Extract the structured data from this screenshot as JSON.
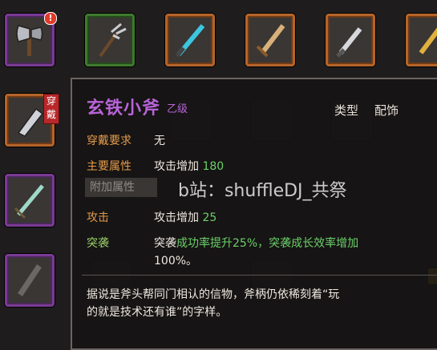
{
  "inventory": {
    "alert_badge": "!",
    "equipped_badge": "穿戴",
    "slots": [
      {
        "icon": "axe-icon",
        "rarity": "purple"
      },
      {
        "icon": "trident-icon",
        "rarity": "green"
      },
      {
        "icon": "cyan-sword-icon",
        "rarity": "orange"
      },
      {
        "icon": "bronze-sword-icon",
        "rarity": "orange"
      },
      {
        "icon": "silver-dagger-icon",
        "rarity": "orange"
      },
      {
        "icon": "gold-sword-icon",
        "rarity": "orange"
      },
      {
        "icon": "broad-blade-icon",
        "rarity": "orange"
      },
      {
        "icon": "jade-sword-icon",
        "rarity": "purple"
      },
      {
        "icon": "dark-blade-icon",
        "rarity": "purple"
      }
    ]
  },
  "tooltip": {
    "item_name": "玄铁小斧",
    "grade": "乙级",
    "type_label": "类型",
    "type_value": "配饰",
    "requirement_label": "穿戴要求",
    "requirement_value": "无",
    "main_attr_label": "主要属性",
    "main_attr_text": "攻击增加",
    "main_attr_value": "180",
    "extra_attr_label": "附加属性",
    "attack_label": "攻击",
    "attack_text": "攻击增加",
    "attack_value": "25",
    "breakthrough_label": "突袭",
    "breakthrough_prefix": "突袭",
    "breakthrough_line1": "成功率提升25%，突袭成长效率增加",
    "breakthrough_line2": "100%。",
    "description_line1": "据说是斧头帮同门相认的信物，斧柄仍依稀刻着“玩",
    "description_line2": "的就是技术还有谁”的字样。"
  },
  "watermark": "b站：shuffleDJ_共祭",
  "colors": {
    "purple_rarity": "#7a3a94",
    "orange_rarity": "#b5642a",
    "green_rarity": "#3f7a2e",
    "item_name": "#b864d8",
    "label_orange": "#e29a4a",
    "label_green": "#9bd06a",
    "value_green": "#6cd16a"
  }
}
